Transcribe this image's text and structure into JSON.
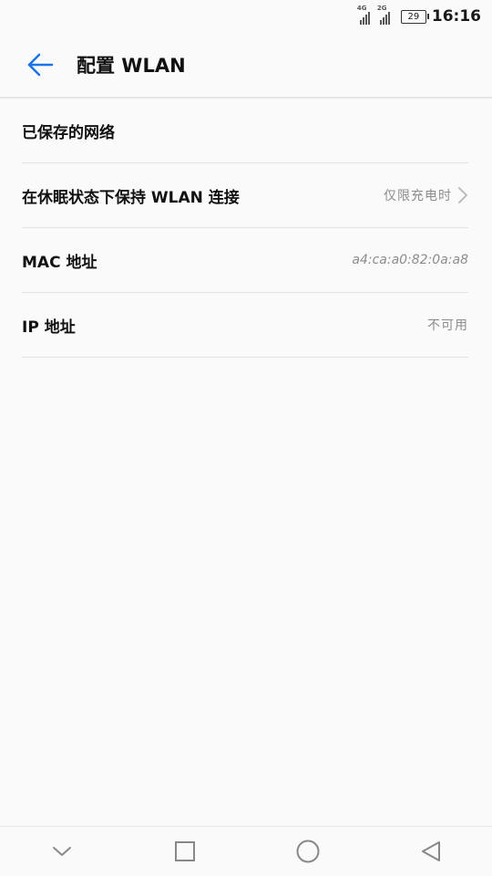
{
  "status_bar": {
    "signal1_type": "4G",
    "signal2_type": "2G",
    "battery": "29",
    "time": "16:16"
  },
  "header": {
    "title": "配置 WLAN",
    "accent_color": "#1a73e8"
  },
  "settings": [
    {
      "label": "已保存的网络",
      "value": ""
    },
    {
      "label": "在休眠状态下保持 WLAN 连接",
      "value": "仅限充电时"
    },
    {
      "label": "MAC 地址",
      "value": "a4:ca:a0:82:0a:a8"
    },
    {
      "label": "IP 地址",
      "value": "不可用"
    }
  ],
  "nav_bar": {
    "icons": [
      "chevron-down-icon",
      "recent-apps-icon",
      "home-icon",
      "back-icon"
    ]
  }
}
